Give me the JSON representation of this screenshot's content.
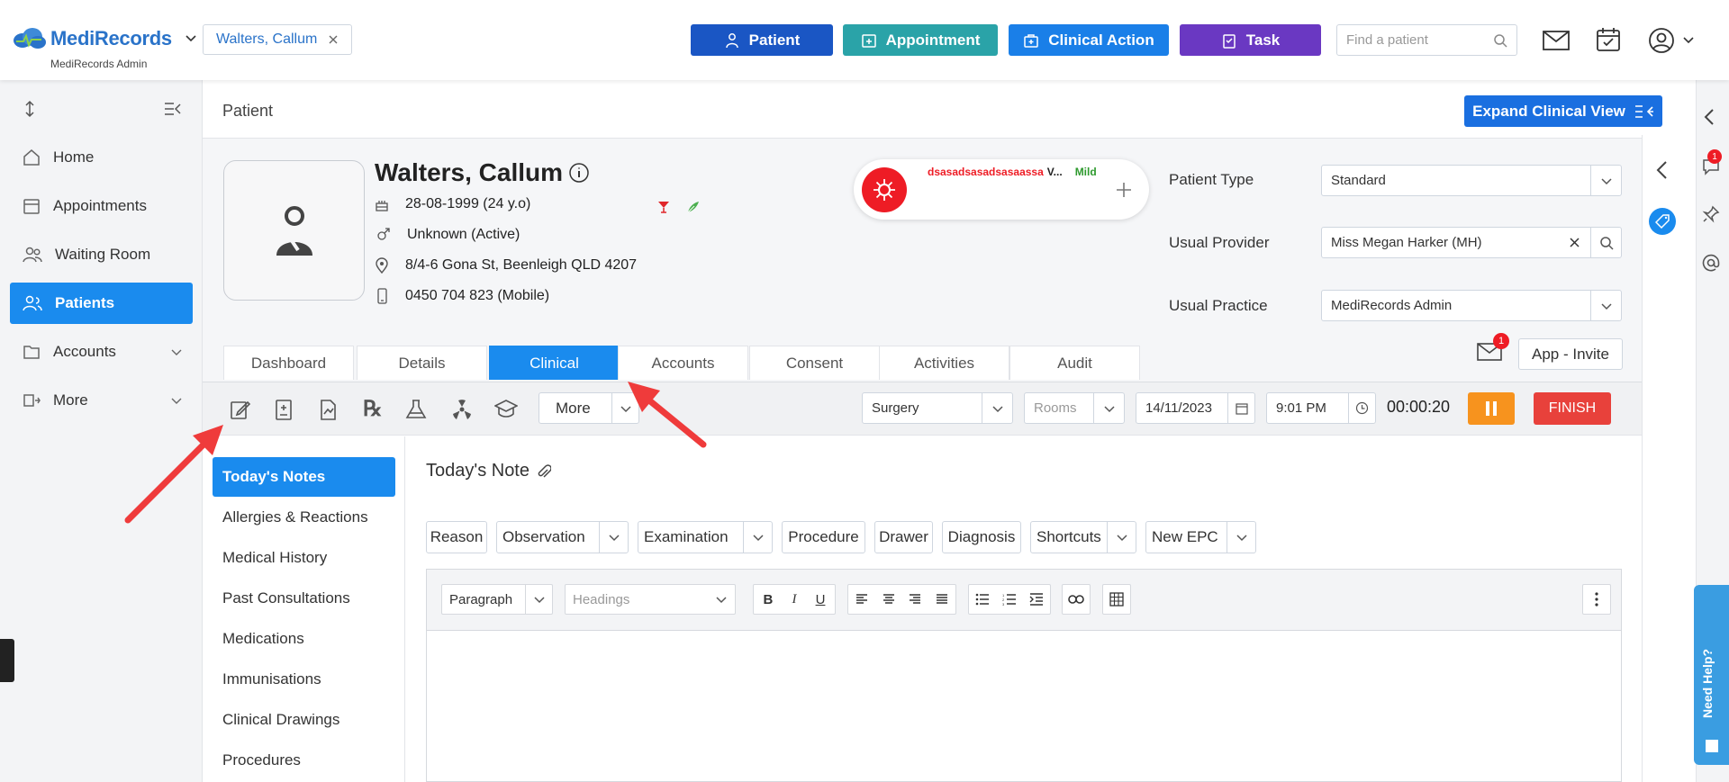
{
  "topbar": {
    "logo": "MediRecords",
    "logo_sub": "MediRecords Admin",
    "patient_chip": "Walters, Callum",
    "buttons": {
      "patient": "Patient",
      "appointment": "Appointment",
      "clinical_action": "Clinical Action",
      "task": "Task"
    },
    "find_placeholder": "Find a patient",
    "colors": {
      "patient": "#1a56c4",
      "appointment": "#2aa3a8",
      "clinical_action": "#1a7fe8",
      "task": "#6a38c2"
    }
  },
  "sidebar": {
    "items": [
      {
        "label": "Home",
        "icon": "home-icon"
      },
      {
        "label": "Appointments",
        "icon": "calendar-icon"
      },
      {
        "label": "Waiting Room",
        "icon": "people-icon"
      },
      {
        "label": "Patients",
        "icon": "users-icon"
      },
      {
        "label": "Accounts",
        "icon": "folder-icon"
      },
      {
        "label": "More",
        "icon": "more-icon"
      }
    ]
  },
  "header": {
    "title": "Patient",
    "expand_label": "Expand Clinical View"
  },
  "patient": {
    "name": "Walters, Callum",
    "dob": "28-08-1999 (24 y.o)",
    "gender": "Unknown (Active)",
    "address": "8/4-6 Gona St, Beenleigh QLD 4207",
    "phone": "0450 704 823 (Mobile)",
    "alert_text": "dsasadsasadsasaassa",
    "alert_trail": "V...",
    "alert_severity": "Mild"
  },
  "fields": {
    "patient_type_label": "Patient Type",
    "patient_type_value": "Standard",
    "usual_provider_label": "Usual Provider",
    "usual_provider_value": "Miss Megan Harker (MH)",
    "usual_practice_label": "Usual Practice",
    "usual_practice_value": "MediRecords Admin"
  },
  "tabs": [
    "Dashboard",
    "Details",
    "Clinical",
    "Accounts",
    "Consent",
    "Activities",
    "Audit"
  ],
  "mail_badge": "1",
  "app_invite": "App - Invite",
  "toolbar": {
    "more": "More",
    "surgery": "Surgery",
    "rooms_placeholder": "Rooms",
    "date": "14/11/2023",
    "time": "9:01 PM",
    "timer": "00:00:20",
    "finish": "FINISH"
  },
  "clinical_nav": [
    "Today's Notes",
    "Allergies & Reactions",
    "Medical History",
    "Past Consultations",
    "Medications",
    "Immunisations",
    "Clinical Drawings",
    "Procedures"
  ],
  "note": {
    "title": "Today's Note",
    "pills": [
      {
        "label": "Reason",
        "dropdown": false
      },
      {
        "label": "Observation",
        "dropdown": true
      },
      {
        "label": "Examination",
        "dropdown": true
      },
      {
        "label": "Procedure",
        "dropdown": false
      },
      {
        "label": "Drawer",
        "dropdown": false
      },
      {
        "label": "Diagnosis",
        "dropdown": false
      },
      {
        "label": "Shortcuts",
        "dropdown": true
      },
      {
        "label": "New EPC",
        "dropdown": true
      }
    ],
    "paragraph": "Paragraph",
    "headings_placeholder": "Headings"
  },
  "right": {
    "chat_badge": "1",
    "help": "Need Help?"
  }
}
